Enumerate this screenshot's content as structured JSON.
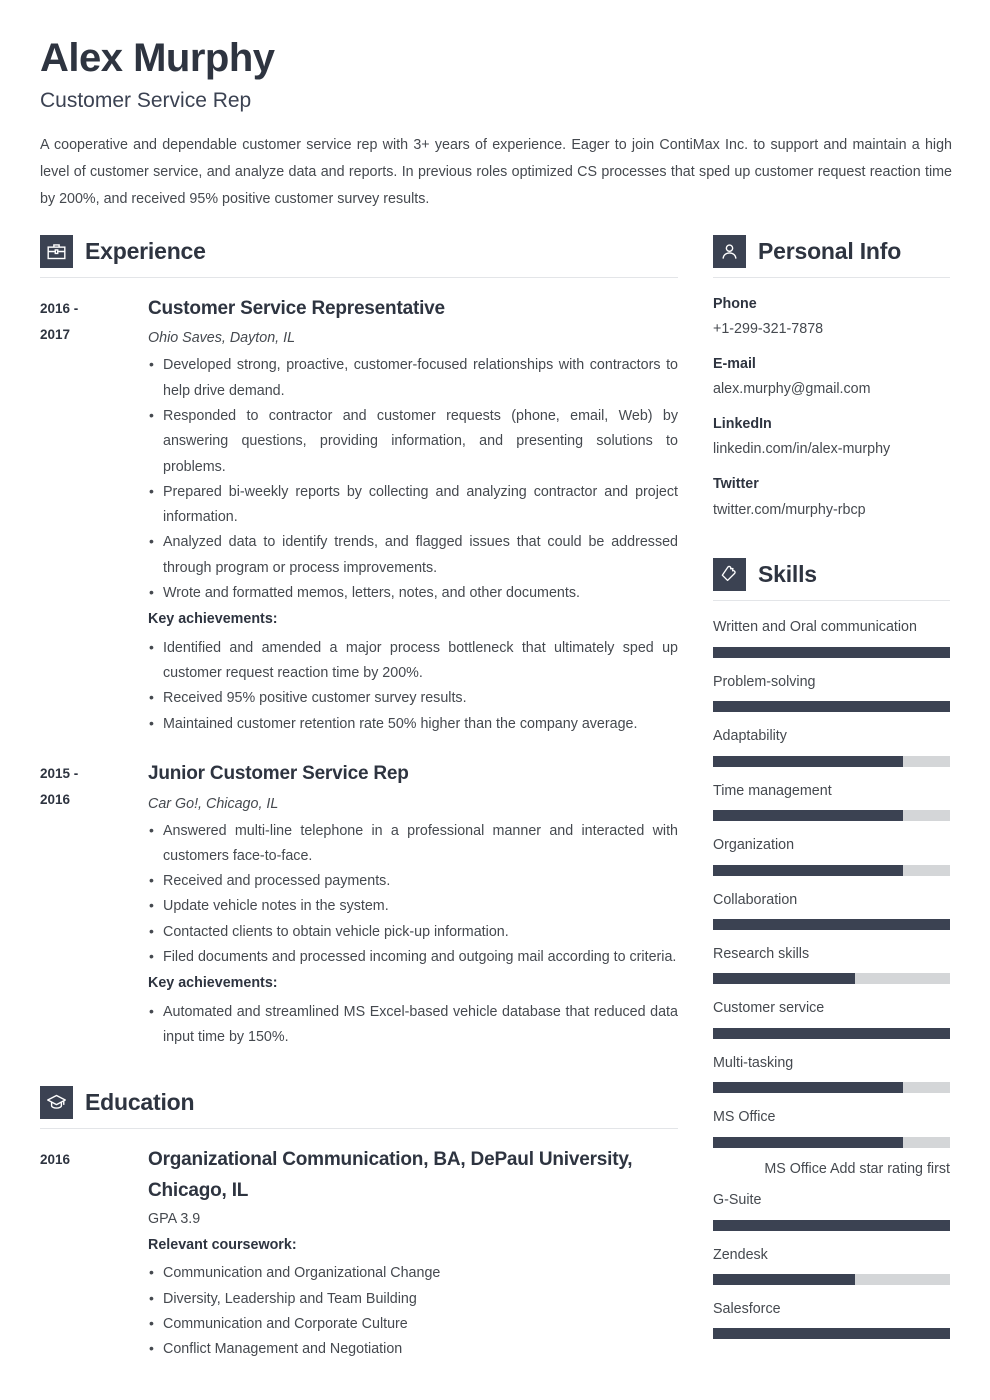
{
  "header": {
    "name": "Alex Murphy",
    "title": "Customer Service Rep",
    "summary": "A cooperative and dependable customer service rep with 3+ years of experience. Eager to join ContiMax Inc. to support and maintain a high level of customer service, and analyze data and reports. In previous roles optimized CS processes that sped up customer request reaction time by 200%, and received 95% positive customer survey results."
  },
  "sections": {
    "experience_title": "Experience",
    "education_title": "Education",
    "personal_info_title": "Personal Info",
    "skills_title": "Skills"
  },
  "experience": [
    {
      "date": "2016 - 2017",
      "title": "Customer Service Representative",
      "subtitle": "Ohio Saves, Dayton, IL",
      "bullets": [
        "Developed strong, proactive, customer-focused relationships with contractors to help drive demand.",
        "Responded to contractor and customer requests (phone, email, Web) by answering questions, providing information, and presenting solutions to problems.",
        "Prepared bi-weekly reports by collecting and analyzing contractor and project information.",
        "Analyzed data to identify trends, and flagged issues that could be addressed through program or process improvements.",
        "Wrote and formatted memos, letters, notes, and other documents."
      ],
      "achievements_label": "Key achievements:",
      "achievements": [
        "Identified and amended a major process bottleneck that ultimately sped up customer request reaction time by 200%.",
        "Received 95% positive customer survey results.",
        "Maintained customer retention rate 50% higher than the company average."
      ]
    },
    {
      "date": "2015 - 2016",
      "title": "Junior Customer Service Rep",
      "subtitle": "Car Go!, Chicago, IL",
      "bullets": [
        "Answered multi-line telephone in a professional manner and interacted with customers face-to-face.",
        "Received and processed payments.",
        "Update vehicle notes in the system.",
        "Contacted clients to obtain vehicle pick-up information.",
        "Filed documents and processed incoming and outgoing mail according to criteria."
      ],
      "achievements_label": "Key achievements:",
      "achievements": [
        "Automated and streamlined MS Excel-based vehicle database that reduced data input time by 150%."
      ]
    }
  ],
  "education": [
    {
      "date": "2016",
      "title": "Organizational Communication, BA, DePaul University, Chicago, IL",
      "gpa": "GPA 3.9",
      "coursework_label": "Relevant coursework:",
      "coursework": [
        "Communication and Organizational Change",
        "Diversity, Leadership and Team Building",
        "Communication and Corporate Culture",
        "Conflict Management and Negotiation"
      ]
    }
  ],
  "personal_info": [
    {
      "label": "Phone",
      "value": "+1-299-321-7878"
    },
    {
      "label": "E-mail",
      "value": "alex.murphy@gmail.com"
    },
    {
      "label": "LinkedIn",
      "value": "linkedin.com/in/alex-murphy"
    },
    {
      "label": "Twitter",
      "value": "twitter.com/murphy-rbcp"
    }
  ],
  "skills": [
    {
      "name": "Written and Oral communication",
      "level": 100
    },
    {
      "name": "Problem-solving",
      "level": 100
    },
    {
      "name": "Adaptability",
      "level": 80
    },
    {
      "name": "Time management",
      "level": 80
    },
    {
      "name": "Organization",
      "level": 80
    },
    {
      "name": "Collaboration",
      "level": 100
    },
    {
      "name": "Research skills",
      "level": 60
    },
    {
      "name": "Customer service",
      "level": 100
    },
    {
      "name": "Multi-tasking",
      "level": 80
    },
    {
      "name": "MS Office",
      "level": 80,
      "note": "MS Office Add star rating first"
    },
    {
      "name": "G-Suite",
      "level": 100
    },
    {
      "name": "Zendesk",
      "level": 60
    },
    {
      "name": "Salesforce",
      "level": 100
    }
  ],
  "colors": {
    "accent": "#3b4252",
    "heading": "#2e3440",
    "body_text": "#45494f",
    "rule": "#e3e5e8",
    "skill_track": "#d4d6d8"
  },
  "icons": {
    "experience": "briefcase-icon",
    "education": "graduation-cap-icon",
    "personal_info": "person-icon",
    "skills": "puzzle-piece-icon"
  }
}
